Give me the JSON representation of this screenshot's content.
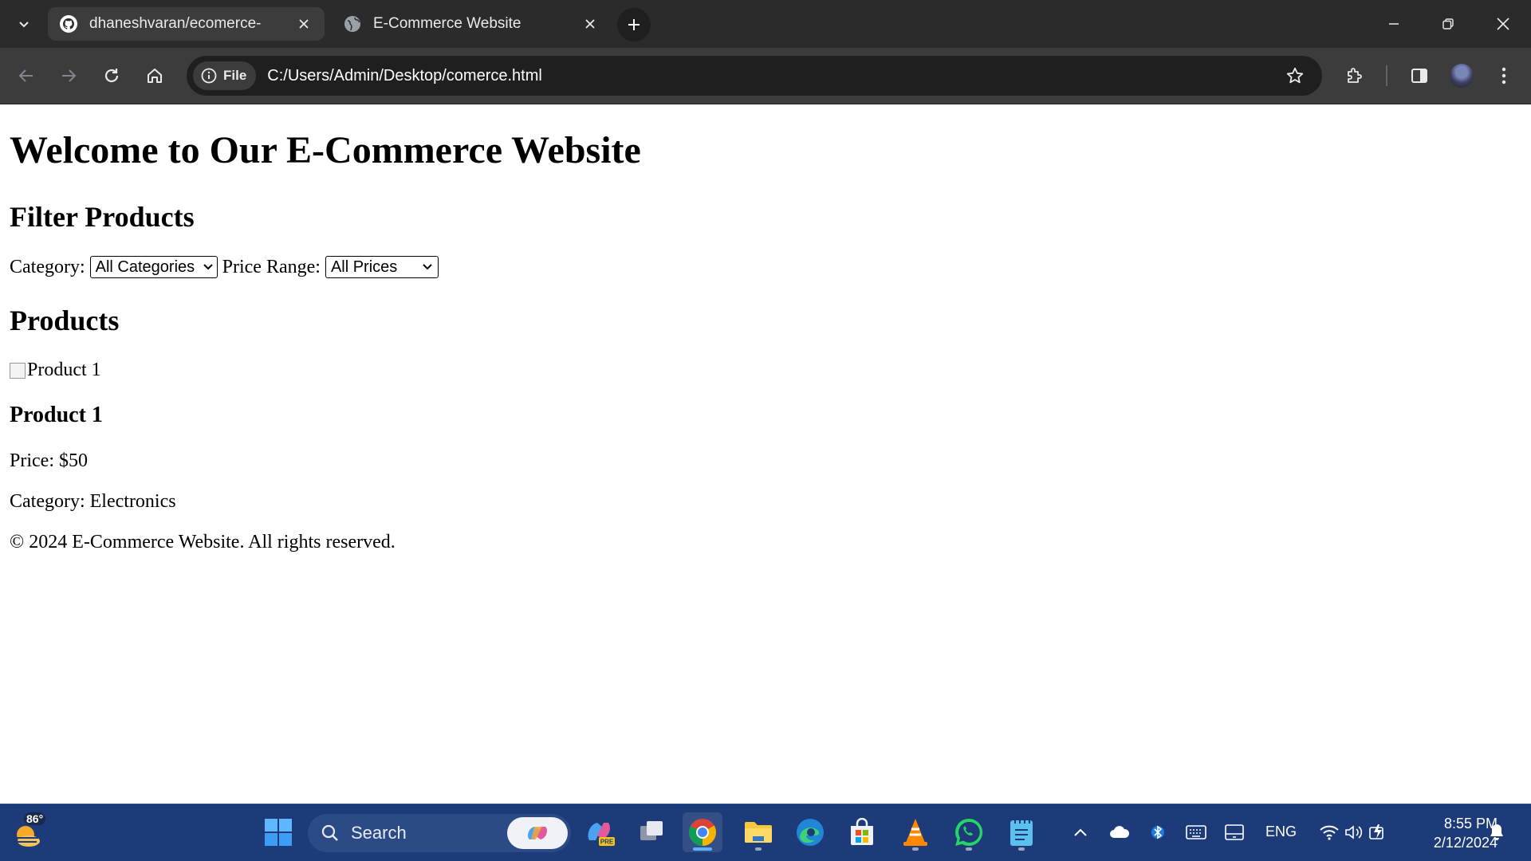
{
  "browser": {
    "tabs": [
      {
        "title": "dhaneshvaran/ecomerce-",
        "icon": "github-icon",
        "active": true
      },
      {
        "title": "E-Commerce Website",
        "icon": "globe-icon",
        "active": false
      }
    ],
    "omnibox": {
      "chip_label": "File",
      "url": "C:/Users/Admin/Desktop/comerce.html"
    },
    "colors": {
      "frame": "#2b2b2c",
      "toolbar": "#3c3c3c",
      "omnibox": "#1f1f1f"
    }
  },
  "page": {
    "title": "Welcome to Our E-Commerce Website",
    "filter_heading": "Filter Products",
    "category_label": "Category:",
    "category_selected": "All Categories",
    "price_label": "Price Range:",
    "price_selected": "All Prices",
    "products_heading": "Products",
    "product": {
      "image_alt": "Product 1",
      "name": "Product 1",
      "price": "Price: $50",
      "category": "Category: Electronics"
    },
    "footer": "© 2024 E-Commerce Website. All rights reserved."
  },
  "taskbar": {
    "weather_temp": "86°",
    "search_label": "Search",
    "apps": [
      "copilot-preview-icon",
      "task-view-icon",
      "chrome-icon",
      "file-explorer-icon",
      "edge-icon",
      "microsoft-store-icon",
      "vlc-icon",
      "whatsapp-icon",
      "notepad-icon"
    ],
    "language": "ENG",
    "time": "8:55 PM",
    "date": "2/12/2024",
    "color": "#1d3b78"
  }
}
